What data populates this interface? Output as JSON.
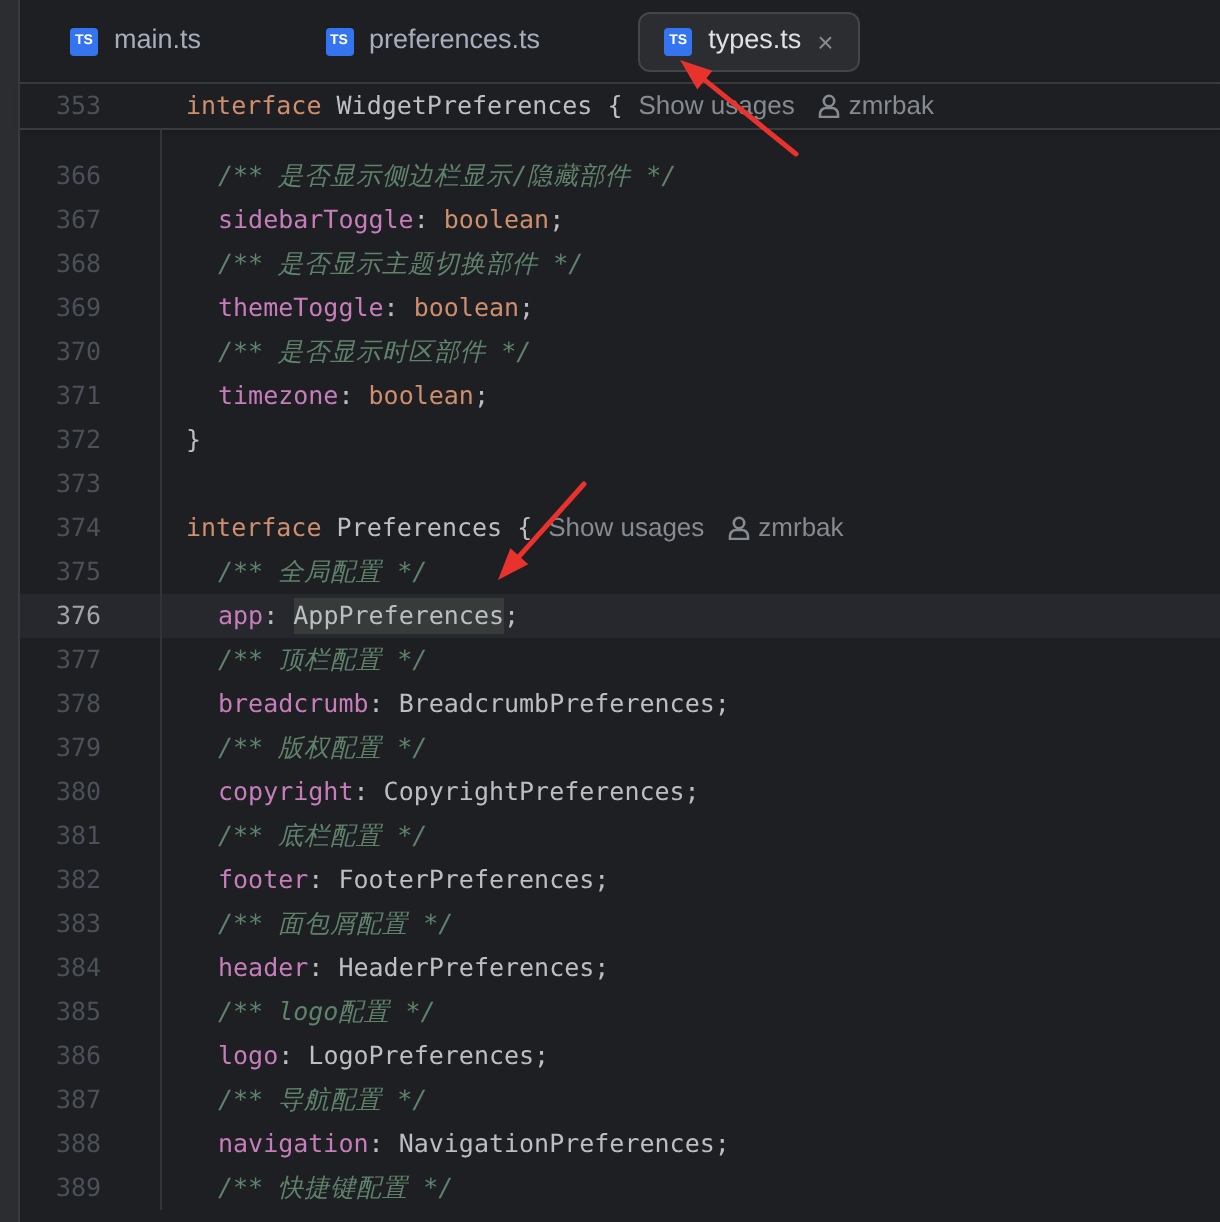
{
  "tabs": [
    {
      "icon_text": "TS",
      "label": "main.ts",
      "selected": false,
      "closable": false
    },
    {
      "icon_text": "TS",
      "label": "preferences.ts",
      "selected": false,
      "closable": false
    },
    {
      "icon_text": "TS",
      "label": "types.ts",
      "selected": true,
      "closable": true,
      "close_glyph": "×"
    }
  ],
  "sticky_line": {
    "number": "353",
    "indented": false,
    "tokens": [
      {
        "kind": "keyword",
        "text": "interface "
      },
      {
        "kind": "type",
        "text": "WidgetPreferences {"
      }
    ],
    "hints": {
      "usages": "Show usages",
      "author": "zmrbak"
    }
  },
  "lines": [
    {
      "number": "366",
      "indented": true,
      "current": false,
      "tokens": [
        {
          "kind": "comment",
          "text": "/** 是否显示侧边栏显示/隐藏部件 */"
        }
      ]
    },
    {
      "number": "367",
      "indented": true,
      "current": false,
      "tokens": [
        {
          "kind": "property",
          "text": "sidebarToggle"
        },
        {
          "kind": "punct",
          "text": ": "
        },
        {
          "kind": "keyword",
          "text": "boolean"
        },
        {
          "kind": "punct",
          "text": ";"
        }
      ]
    },
    {
      "number": "368",
      "indented": true,
      "current": false,
      "tokens": [
        {
          "kind": "comment",
          "text": "/** 是否显示主题切换部件 */"
        }
      ]
    },
    {
      "number": "369",
      "indented": true,
      "current": false,
      "tokens": [
        {
          "kind": "property",
          "text": "themeToggle"
        },
        {
          "kind": "punct",
          "text": ": "
        },
        {
          "kind": "keyword",
          "text": "boolean"
        },
        {
          "kind": "punct",
          "text": ";"
        }
      ]
    },
    {
      "number": "370",
      "indented": true,
      "current": false,
      "tokens": [
        {
          "kind": "comment",
          "text": "/** 是否显示时区部件 */"
        }
      ]
    },
    {
      "number": "371",
      "indented": true,
      "current": false,
      "tokens": [
        {
          "kind": "property",
          "text": "timezone"
        },
        {
          "kind": "punct",
          "text": ": "
        },
        {
          "kind": "keyword",
          "text": "boolean"
        },
        {
          "kind": "punct",
          "text": ";"
        }
      ]
    },
    {
      "number": "372",
      "indented": false,
      "current": false,
      "tokens": [
        {
          "kind": "punct",
          "text": "}"
        }
      ]
    },
    {
      "number": "373",
      "current": false
    },
    {
      "number": "374",
      "indented": false,
      "current": false,
      "tokens": [
        {
          "kind": "keyword",
          "text": "interface "
        },
        {
          "kind": "type",
          "text": "Preferences {"
        }
      ],
      "hints": {
        "usages": "Show usages",
        "author": "zmrbak"
      }
    },
    {
      "number": "375",
      "indented": true,
      "current": false,
      "tokens": [
        {
          "kind": "comment",
          "text": "/** 全局配置 */"
        }
      ]
    },
    {
      "number": "376",
      "indented": true,
      "current": true,
      "tokens": [
        {
          "kind": "property",
          "text": "app"
        },
        {
          "kind": "punct",
          "text": ": "
        },
        {
          "kind": "highlight",
          "text": "AppPreferences"
        },
        {
          "kind": "punct",
          "text": ";"
        }
      ]
    },
    {
      "number": "377",
      "indented": true,
      "current": false,
      "tokens": [
        {
          "kind": "comment",
          "text": "/** 顶栏配置 */"
        }
      ]
    },
    {
      "number": "378",
      "indented": true,
      "current": false,
      "tokens": [
        {
          "kind": "property",
          "text": "breadcrumb"
        },
        {
          "kind": "punct",
          "text": ": "
        },
        {
          "kind": "type",
          "text": "BreadcrumbPreferences;"
        }
      ]
    },
    {
      "number": "379",
      "indented": true,
      "current": false,
      "tokens": [
        {
          "kind": "comment",
          "text": "/** 版权配置 */"
        }
      ]
    },
    {
      "number": "380",
      "indented": true,
      "current": false,
      "tokens": [
        {
          "kind": "property",
          "text": "copyright"
        },
        {
          "kind": "punct",
          "text": ": "
        },
        {
          "kind": "type",
          "text": "CopyrightPreferences;"
        }
      ]
    },
    {
      "number": "381",
      "indented": true,
      "current": false,
      "tokens": [
        {
          "kind": "comment",
          "text": "/** 底栏配置 */"
        }
      ]
    },
    {
      "number": "382",
      "indented": true,
      "current": false,
      "tokens": [
        {
          "kind": "property",
          "text": "footer"
        },
        {
          "kind": "punct",
          "text": ": "
        },
        {
          "kind": "type",
          "text": "FooterPreferences;"
        }
      ]
    },
    {
      "number": "383",
      "indented": true,
      "current": false,
      "tokens": [
        {
          "kind": "comment",
          "text": "/** 面包屑配置 */"
        }
      ]
    },
    {
      "number": "384",
      "indented": true,
      "current": false,
      "tokens": [
        {
          "kind": "property",
          "text": "header"
        },
        {
          "kind": "punct",
          "text": ": "
        },
        {
          "kind": "type",
          "text": "HeaderPreferences;"
        }
      ]
    },
    {
      "number": "385",
      "indented": true,
      "current": false,
      "tokens": [
        {
          "kind": "comment",
          "text": "/** logo配置 */"
        }
      ]
    },
    {
      "number": "386",
      "indented": true,
      "current": false,
      "tokens": [
        {
          "kind": "property",
          "text": "logo"
        },
        {
          "kind": "punct",
          "text": ": "
        },
        {
          "kind": "type",
          "text": "LogoPreferences;"
        }
      ]
    },
    {
      "number": "387",
      "indented": true,
      "current": false,
      "tokens": [
        {
          "kind": "comment",
          "text": "/** 导航配置 */"
        }
      ]
    },
    {
      "number": "388",
      "indented": true,
      "current": false,
      "tokens": [
        {
          "kind": "property",
          "text": "navigation"
        },
        {
          "kind": "punct",
          "text": ": "
        },
        {
          "kind": "type",
          "text": "NavigationPreferences;"
        }
      ]
    },
    {
      "number": "389",
      "indented": true,
      "current": false,
      "tokens": [
        {
          "kind": "comment",
          "text": "/** 快捷键配置 */"
        }
      ]
    }
  ]
}
